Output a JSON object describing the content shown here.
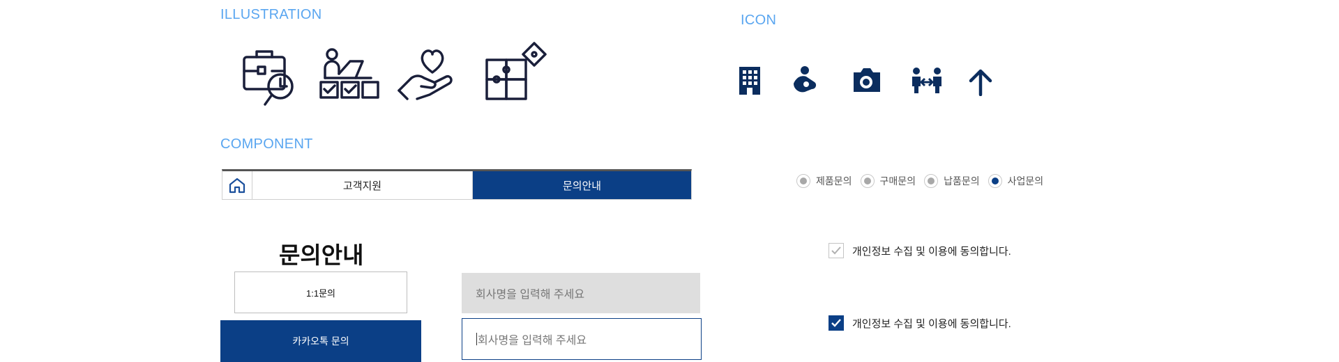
{
  "sections": {
    "illustration": "ILLUSTRATION",
    "icon": "ICON",
    "component": "COMPONENT"
  },
  "illustrations": [
    "briefcase-search-icon",
    "person-checklist-icon",
    "hand-heart-icon",
    "puzzle-icon"
  ],
  "icons": [
    "building-icon",
    "person-care-icon",
    "camera-icon",
    "people-exchange-icon",
    "arrow-up-icon"
  ],
  "breadcrumb": {
    "home_icon": "home-icon",
    "item1": "고객지원",
    "item2": "문의안내"
  },
  "page_title": "문의안내",
  "buttons": {
    "one_to_one": "1:1문의",
    "kakao": "카카오톡 문의"
  },
  "inputs": {
    "company_placeholder": "회사명을 입력해 주세요",
    "company_focused_placeholder": "회사명을 입력해 주세요"
  },
  "radios": [
    {
      "label": "제품문의",
      "selected": false
    },
    {
      "label": "구매문의",
      "selected": false
    },
    {
      "label": "납품문의",
      "selected": false
    },
    {
      "label": "사업문의",
      "selected": true
    }
  ],
  "consent": {
    "unchecked_label": "개인정보 수집 및 이용에 동의합니다.",
    "checked_label": "개인정보 수집 및 이용에 동의합니다."
  },
  "colors": {
    "accent": "#0b3f86",
    "section_title": "#5aa6f0",
    "illustration_stroke": "#1a1f3a"
  }
}
